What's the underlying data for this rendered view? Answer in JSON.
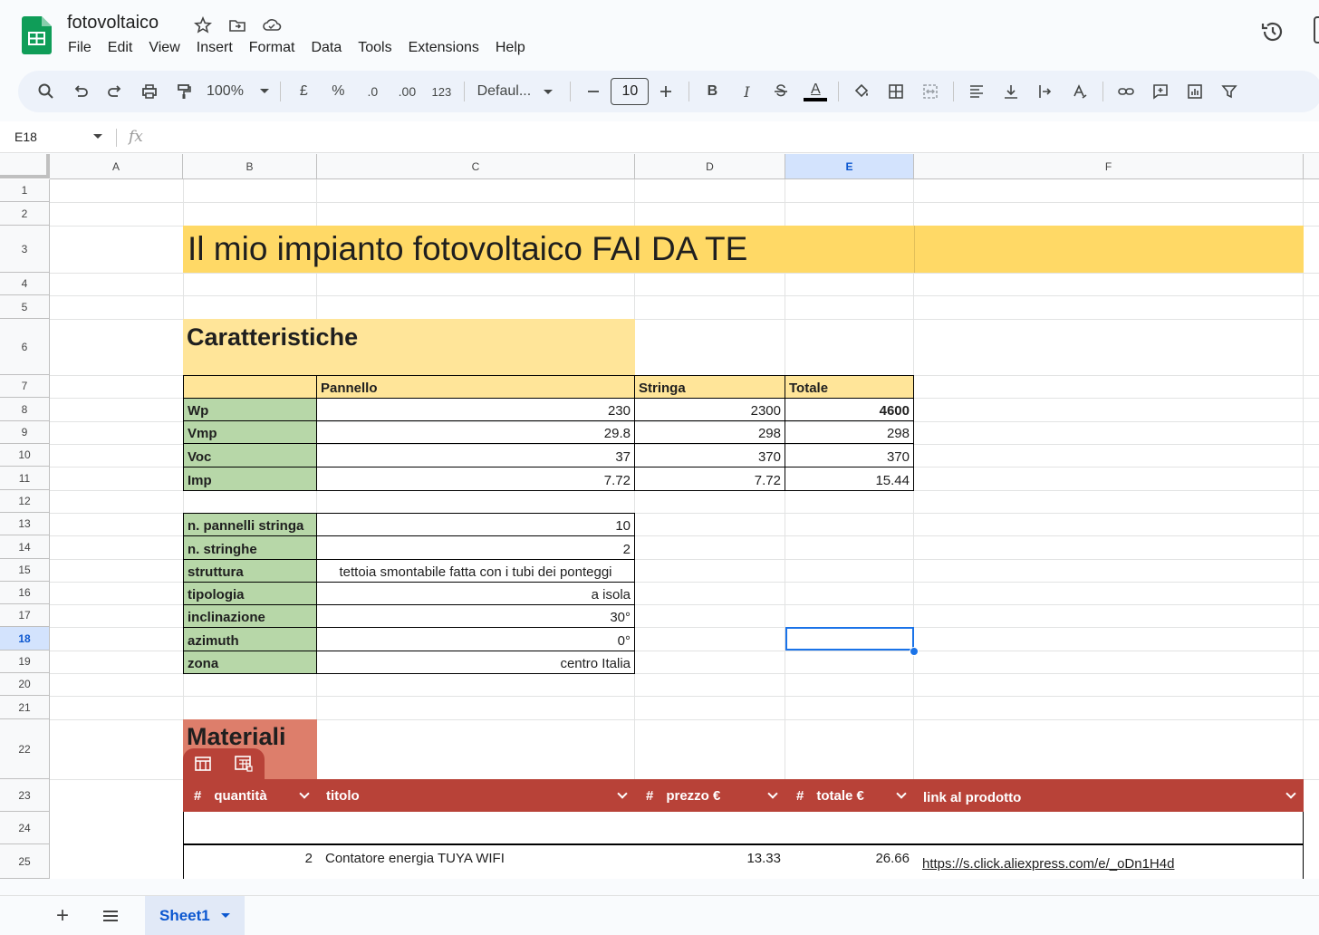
{
  "app": {
    "doc_title": "fotovoltaico",
    "menu": [
      "File",
      "Edit",
      "View",
      "Insert",
      "Format",
      "Data",
      "Tools",
      "Extensions",
      "Help"
    ]
  },
  "toolbar": {
    "zoom": "100%",
    "currency": "£",
    "percent": "%",
    "dec_decrease": ".0",
    "dec_increase": ".00",
    "number_format": "123",
    "font": "Defaul...",
    "font_size": "10",
    "bold": "B",
    "italic": "I",
    "text_color": "A"
  },
  "formula_bar": {
    "name_box": "E18",
    "fx": "fx",
    "formula": ""
  },
  "columns": [
    "A",
    "B",
    "C",
    "D",
    "E",
    "F"
  ],
  "selected_column": "E",
  "rows": [
    "1",
    "2",
    "3",
    "4",
    "5",
    "6",
    "7",
    "8",
    "9",
    "10",
    "11",
    "12",
    "13",
    "14",
    "15",
    "16",
    "17",
    "18",
    "19",
    "20",
    "21",
    "22",
    "23",
    "24",
    "25"
  ],
  "selected_row": "18",
  "sheet": {
    "title": "Il mio impianto fotovoltaico FAI DA TE",
    "caratteristiche": "Caratteristiche",
    "table1": {
      "headers": [
        "Pannello",
        "Stringa",
        "Totale"
      ],
      "rows": [
        {
          "label": "Wp",
          "pannello": "230",
          "stringa": "2300",
          "totale": "4600"
        },
        {
          "label": "Vmp",
          "pannello": "29.8",
          "stringa": "298",
          "totale": "298"
        },
        {
          "label": "Voc",
          "pannello": "37",
          "stringa": "370",
          "totale": "370"
        },
        {
          "label": "Imp",
          "pannello": "7.72",
          "stringa": "7.72",
          "totale": "15.44"
        }
      ]
    },
    "table2": [
      {
        "label": "n. pannelli stringa",
        "value": "10"
      },
      {
        "label": "n. stringhe",
        "value": "2"
      },
      {
        "label": "struttura",
        "value": "tettoia smontabile fatta con i tubi dei ponteggi"
      },
      {
        "label": "tipologia",
        "value": "a isola"
      },
      {
        "label": "inclinazione",
        "value": "30°"
      },
      {
        "label": "azimuth",
        "value": "0°"
      },
      {
        "label": "zona",
        "value": "centro Italia"
      }
    ],
    "materiali": "Materiali",
    "materials_table": {
      "columns": [
        "quantità",
        "titolo",
        "prezzo €",
        "totale €",
        "link al prodotto"
      ],
      "hash": "#",
      "rows": [
        {
          "quantita": "2",
          "titolo": "Contatore energia TUYA WIFI",
          "prezzo": "13.33",
          "totale": "26.66",
          "link": "https://s.click.aliexpress.com/e/_oDn1H4d"
        }
      ]
    }
  },
  "bottom": {
    "add": "+",
    "sheet_name": "Sheet1"
  },
  "colors": {
    "title_bg": "#ffd966",
    "header_bg": "#ffe599",
    "label_bg": "#b7d7a8",
    "materials_bg": "#b84238",
    "selection": "#1a73e8"
  }
}
